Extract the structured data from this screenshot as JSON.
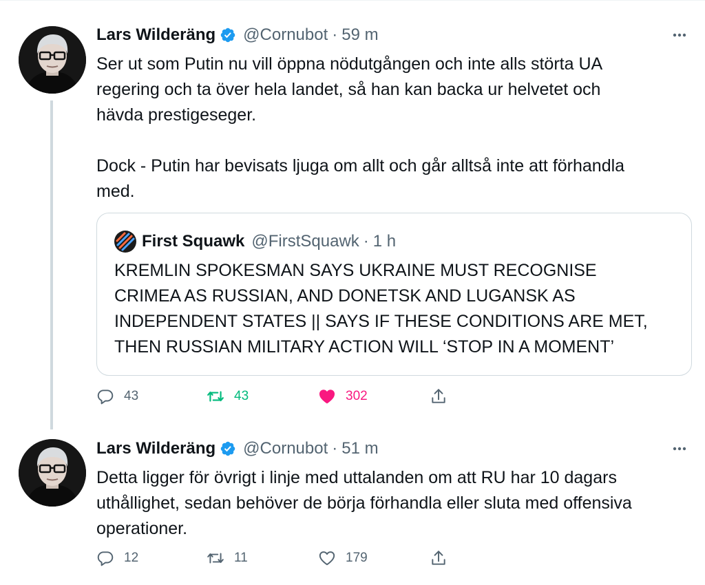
{
  "tweets": [
    {
      "author_name": "Lars Wilderäng",
      "handle": "@Cornubot",
      "separator": "·",
      "time": "59 m",
      "text_lines": [
        "Ser ut som Putin nu vill öppna nödutgången och inte alls störta UA",
        "regering och ta över hela landet, så han kan backa ur helvetet och",
        "hävda prestigeseger.",
        "",
        "Dock - Putin har bevisats ljuga om allt och går alltså inte att förhandla",
        "med."
      ],
      "quoted": {
        "author_name": "First Squawk",
        "handle": "@FirstSquawk",
        "separator": "·",
        "time": "1 h",
        "text_lines": [
          "KREMLIN SPOKESMAN SAYS UKRAINE MUST RECOGNISE",
          "CRIMEA AS RUSSIAN, AND DONETSK AND LUGANSK AS",
          "INDEPENDENT STATES || SAYS IF THESE CONDITIONS ARE MET,",
          "THEN RUSSIAN MILITARY ACTION WILL ‘STOP IN A MOMENT’"
        ]
      },
      "replies": "43",
      "retweets": "43",
      "likes": "302",
      "retweeted": true,
      "liked": true
    },
    {
      "author_name": "Lars Wilderäng",
      "handle": "@Cornubot",
      "separator": "·",
      "time": "51 m",
      "text_lines": [
        "Detta ligger för övrigt i linje med uttalanden om att RU har 10 dagars",
        "uthållighet, sedan behöver de börja förhandla eller sluta med offensiva",
        "operationer."
      ],
      "replies": "12",
      "retweets": "11",
      "likes": "179",
      "retweeted": false,
      "liked": false
    }
  ],
  "colors": {
    "text": "#0f1419",
    "secondary": "#536471",
    "verified": "#1d9bf0",
    "retweet_active": "#00ba7c",
    "like_active": "#f91880",
    "border": "#cfd9de"
  },
  "icons": {
    "verified": "verified-badge-icon",
    "more": "more-horizontal-icon",
    "reply": "reply-icon",
    "retweet": "retweet-icon",
    "like": "heart-icon",
    "share": "share-icon"
  }
}
